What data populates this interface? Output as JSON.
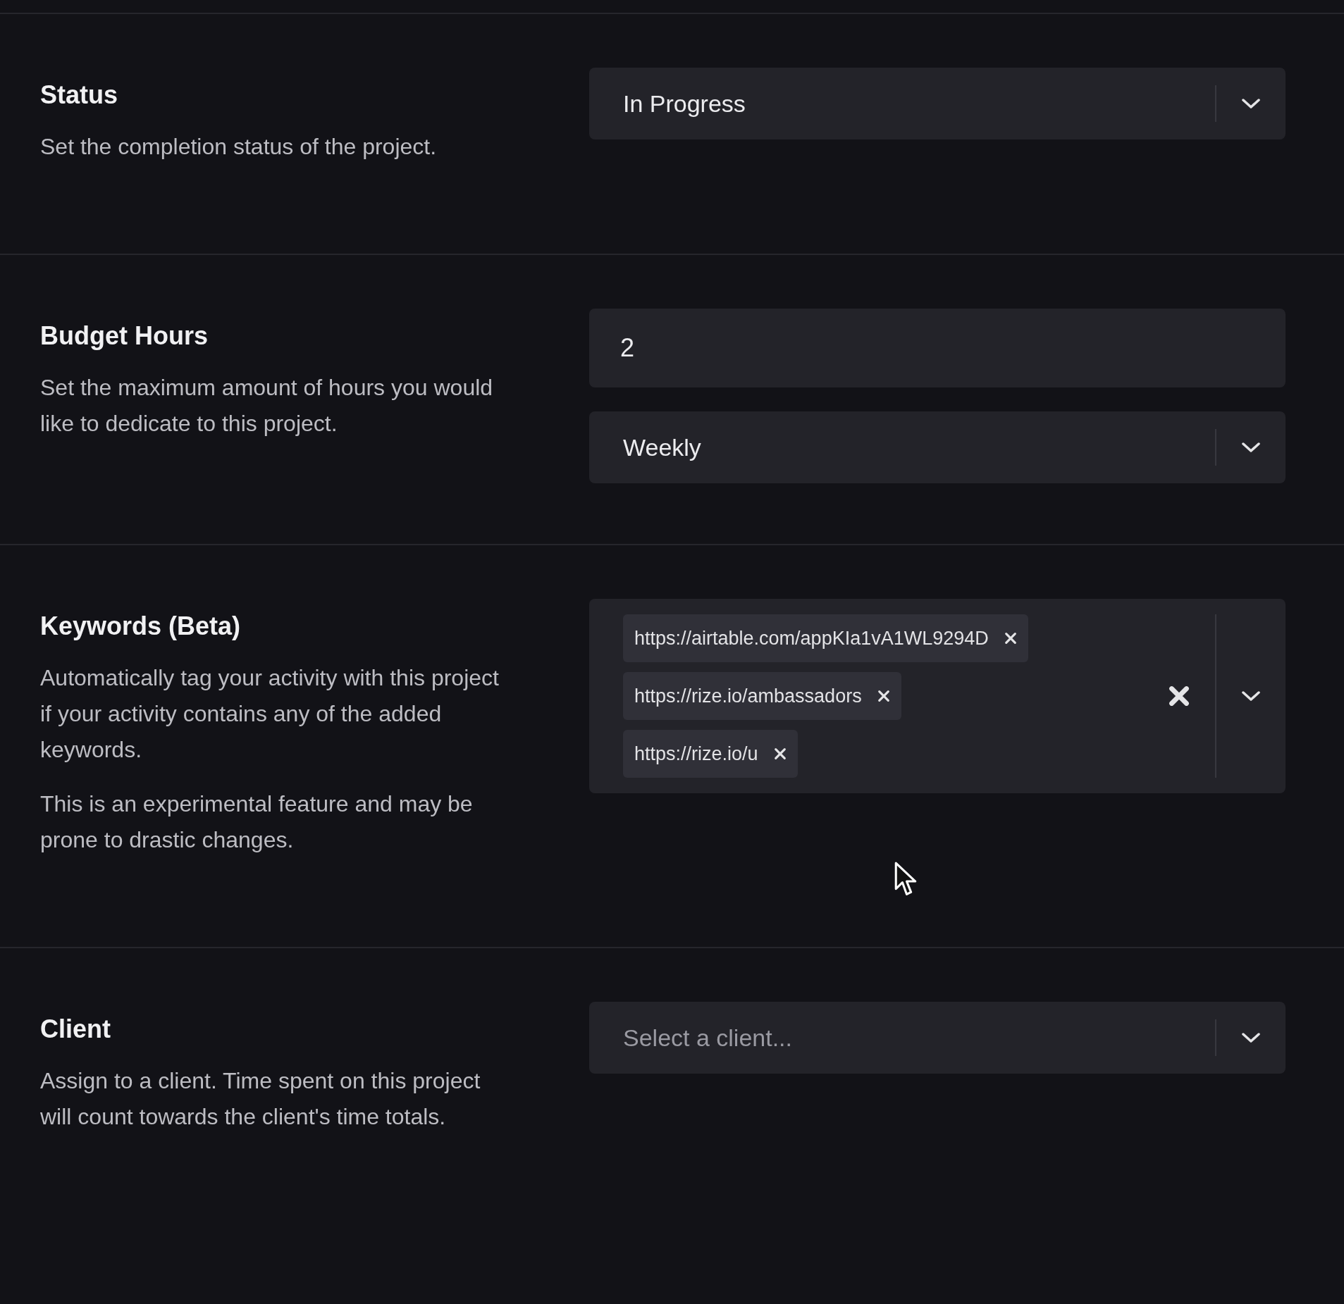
{
  "sections": [
    {
      "title": "Status",
      "description": [
        "Set the completion status of the project."
      ],
      "controls": [
        {
          "kind": "select",
          "value": "In Progress"
        }
      ]
    },
    {
      "title": "Budget Hours",
      "description": [
        "Set the maximum amount of hours you would like to dedicate to this project."
      ],
      "controls": [
        {
          "kind": "input",
          "value": "2"
        },
        {
          "kind": "select",
          "value": "Weekly"
        }
      ]
    },
    {
      "title": "Keywords (Beta)",
      "description": [
        "Automatically tag your activity with this project if your activity contains any of the added keywords.",
        "This is an experimental feature and may be prone to drastic changes."
      ],
      "controls": [
        {
          "kind": "tags",
          "tags": [
            "https://airtable.com/appKIa1vA1WL9294D",
            "https://rize.io/ambassadors",
            "https://rize.io/u"
          ]
        }
      ]
    },
    {
      "title": "Client",
      "description": [
        "Assign to a client. Time spent on this project will count towards the client's time totals."
      ],
      "controls": [
        {
          "kind": "select",
          "placeholder": "Select a client..."
        }
      ]
    }
  ]
}
